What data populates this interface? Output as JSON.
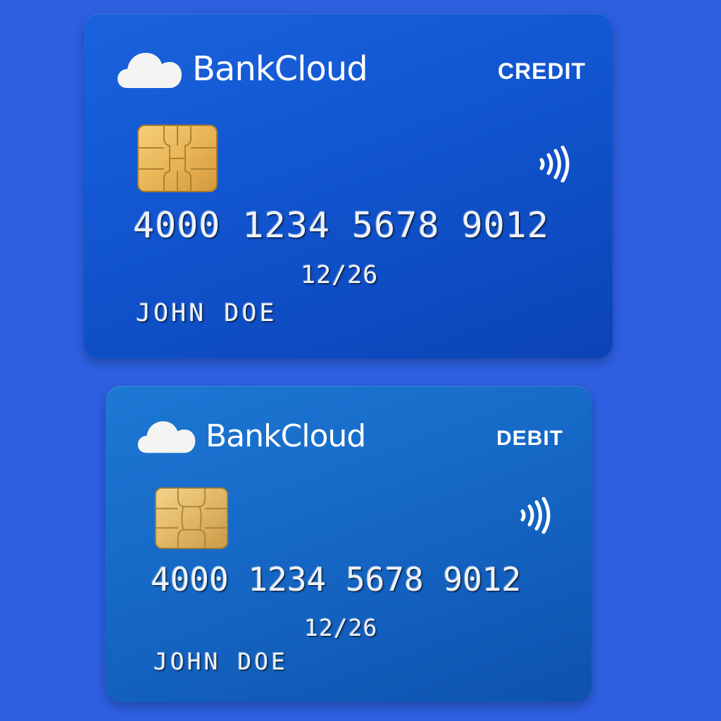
{
  "cards": [
    {
      "brand": "BankCloud",
      "type": "CREDIT",
      "number": "4000 1234 5678 9012",
      "expiry": "12/26",
      "holder": "JOHN DOE",
      "background_color": "#1155cf",
      "icons": [
        "cloud-icon",
        "chip-icon",
        "contactless-icon"
      ]
    },
    {
      "brand": "BankCloud",
      "type": "DEBIT",
      "number": "4000 1234 5678 9012",
      "expiry": "12/26",
      "holder": "JOHN DOE",
      "background_color": "#1668c6",
      "icons": [
        "cloud-icon",
        "chip-icon",
        "contactless-icon"
      ]
    }
  ],
  "colors": {
    "page_background": "#2e5fe0",
    "chip_gold": "#e9b95a",
    "text": "#ffffff"
  }
}
